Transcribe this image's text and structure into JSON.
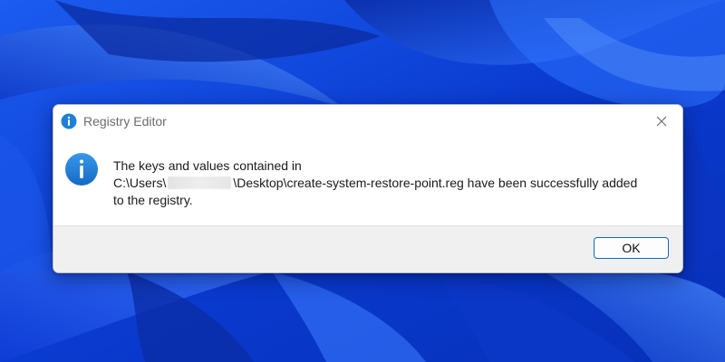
{
  "dialog": {
    "title": "Registry Editor",
    "title_icon": "info-icon",
    "close_icon": "close-icon",
    "message": {
      "line1": "The keys and values contained in",
      "line2_prefix": "C:\\Users\\",
      "line2_suffix": "\\Desktop\\create-system-restore-point.reg have been successfully added",
      "line3": "to the registry."
    },
    "body_icon": "information-icon",
    "ok_label": "OK"
  },
  "colors": {
    "accent": "#0a6cc7",
    "info_icon": "#1f7fd6",
    "wallpaper_base": "#0b3fd8"
  }
}
